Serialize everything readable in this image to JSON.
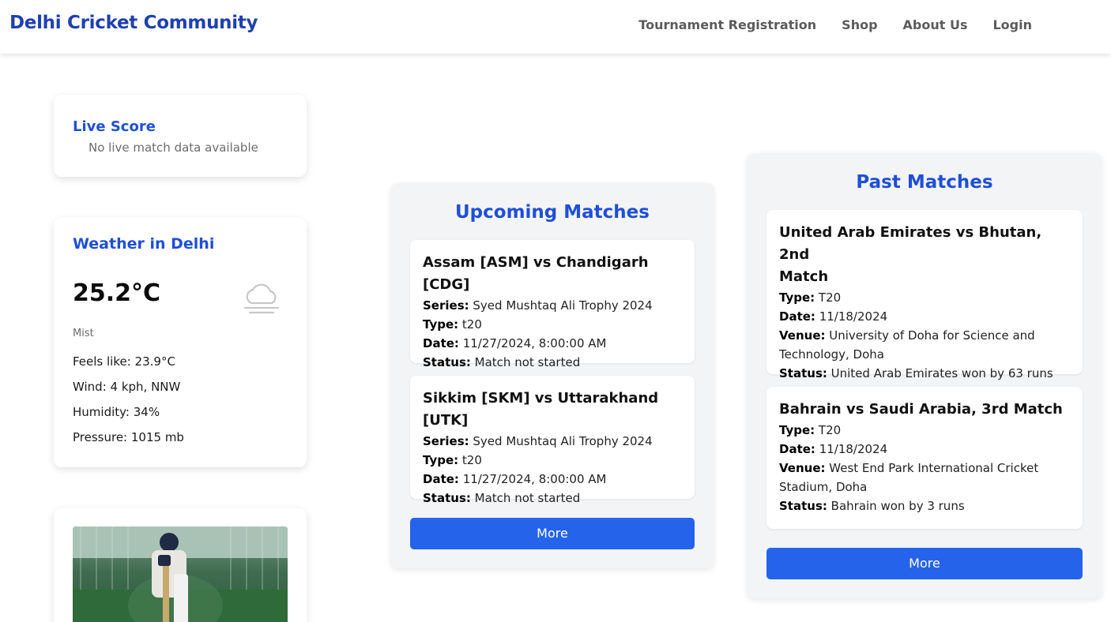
{
  "header": {
    "brand": "Delhi Cricket Community",
    "nav": [
      "Tournament Registration",
      "Shop",
      "About Us",
      "Login"
    ]
  },
  "live_score": {
    "title": "Live Score",
    "message": "No live match data available"
  },
  "weather": {
    "title": "Weather in Delhi",
    "temperature": "25.2°C",
    "condition": "Mist",
    "icon": "cloud-fog-icon",
    "details": [
      "Feels like: 23.9°C",
      "Wind: 4 kph, NNW",
      "Humidity: 34%",
      "Pressure: 1015 mb"
    ]
  },
  "upcoming": {
    "title": "Upcoming Matches",
    "matches": [
      {
        "title": "Assam [ASM] vs Chandigarh [CDG]",
        "series_label": "Series:",
        "series": "Syed Mushtaq Ali Trophy 2024",
        "type_label": "Type:",
        "type": "t20",
        "date_label": "Date:",
        "date": "11/27/2024, 8:00:00 AM",
        "status_label": "Status:",
        "status": "Match not started"
      },
      {
        "title": "Sikkim [SKM] vs Uttarakhand [UTK]",
        "series_label": "Series:",
        "series": "Syed Mushtaq Ali Trophy 2024",
        "type_label": "Type:",
        "type": "t20",
        "date_label": "Date:",
        "date": "11/27/2024, 8:00:00 AM",
        "status_label": "Status:",
        "status": "Match not started"
      }
    ],
    "more": "More"
  },
  "past": {
    "title": "Past Matches",
    "matches": [
      {
        "title_line1": "United Arab Emirates vs Bhutan, 2nd",
        "title_line2": "Match",
        "type_label": "Type:",
        "type": "T20",
        "date_label": "Date:",
        "date": "11/18/2024",
        "venue_label": "Venue:",
        "venue_line1": "University of Doha for Science and",
        "venue_line2": "Technology, Doha",
        "status_label": "Status:",
        "status": "United Arab Emirates won by 63 runs"
      },
      {
        "title_line1": "Bahrain vs Saudi Arabia, 3rd Match",
        "type_label": "Type:",
        "type": "T20",
        "date_label": "Date:",
        "date": "11/18/2024",
        "venue_label": "Venue:",
        "venue_line1": "West End Park International Cricket",
        "venue_line2": "Stadium, Doha",
        "status_label": "Status:",
        "status": "Bahrain won by 3 runs"
      }
    ],
    "more": "More"
  },
  "colors": {
    "brand": "#1e40af",
    "heading": "#1e4fd8",
    "button": "#2563eb",
    "panel": "#f3f4f6"
  }
}
